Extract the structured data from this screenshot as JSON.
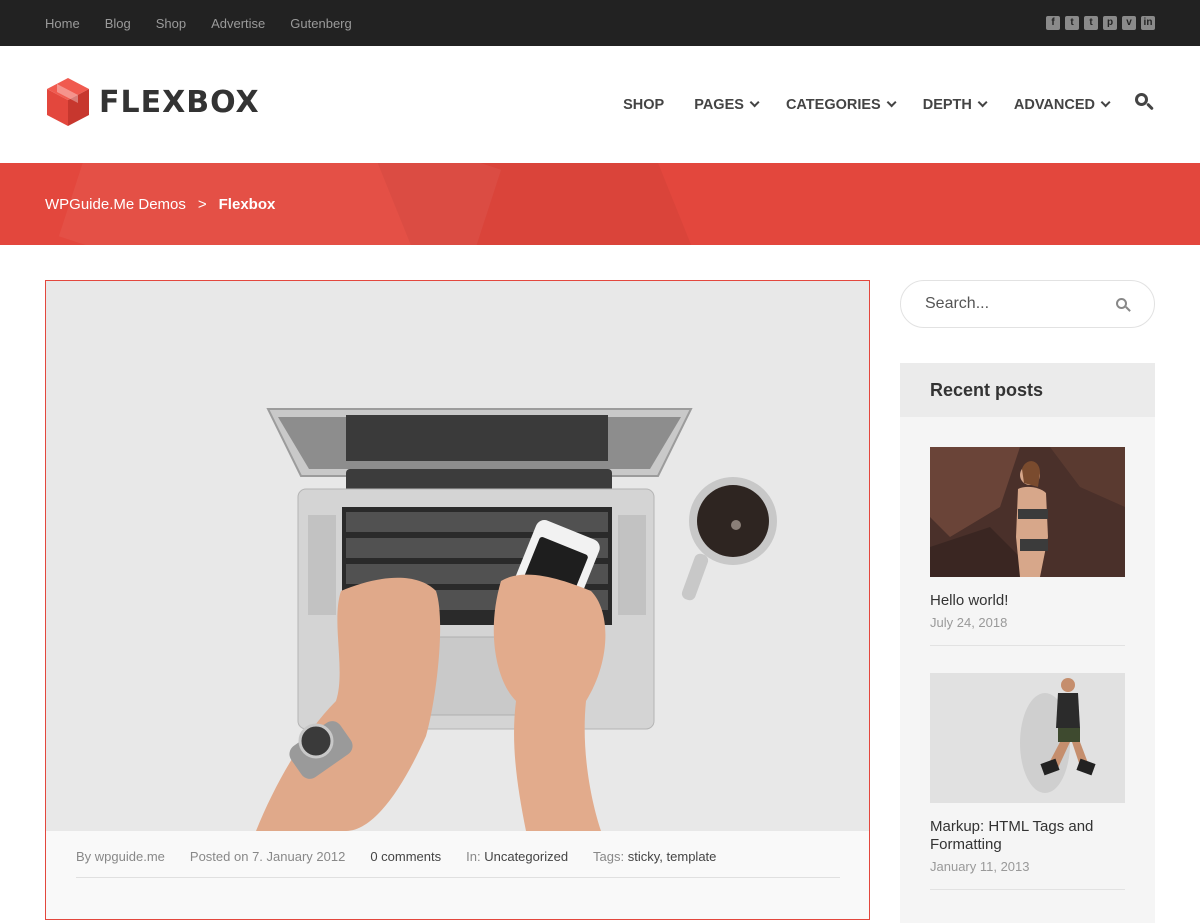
{
  "topbar": {
    "links": [
      "Home",
      "Blog",
      "Shop",
      "Advertise",
      "Gutenberg"
    ],
    "social_icons": [
      "facebook-icon",
      "twitter-icon",
      "tumblr-icon",
      "pinterest-icon",
      "vimeo-icon",
      "linkedin-icon"
    ]
  },
  "header": {
    "logo_text": "FLEXBOX",
    "nav": [
      {
        "label": "SHOP",
        "dropdown": false
      },
      {
        "label": "PAGES",
        "dropdown": true
      },
      {
        "label": "CATEGORIES",
        "dropdown": true
      },
      {
        "label": "DEPTH",
        "dropdown": true
      },
      {
        "label": "ADVANCED",
        "dropdown": true
      }
    ]
  },
  "breadcrumb": {
    "parent": "WPGuide.Me Demos",
    "separator": ">",
    "current": "Flexbox"
  },
  "post": {
    "meta": {
      "by_prefix": "By",
      "author": "wpguide.me",
      "posted_prefix": "Posted on",
      "date": "7. January 2012",
      "comments": "0 comments",
      "in_prefix": "In:",
      "category": "Uncategorized",
      "tags_prefix": "Tags:",
      "tags": [
        "sticky",
        "template"
      ]
    }
  },
  "sidebar": {
    "search_placeholder": "Search...",
    "recent_title": "Recent posts",
    "recent_posts": [
      {
        "title": "Hello world!",
        "date": "July 24, 2018"
      },
      {
        "title": "Markup: HTML Tags and Formatting",
        "date": "January 11, 2013"
      }
    ]
  },
  "colors": {
    "accent": "#e3473d",
    "topbar": "#222222"
  }
}
